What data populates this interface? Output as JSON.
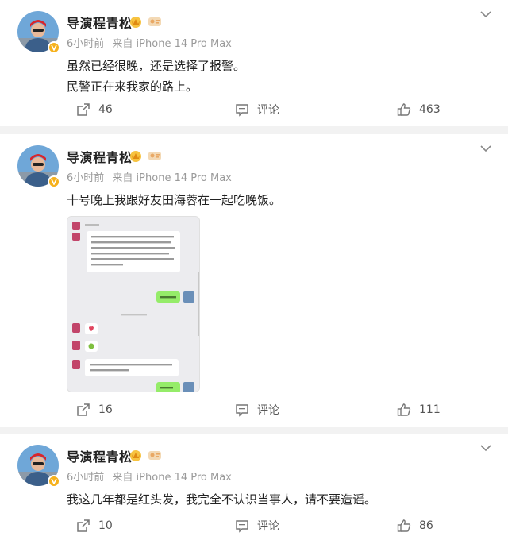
{
  "posts": [
    {
      "author": "导演程青松",
      "time": "6小时前",
      "source": "来自 iPhone 14 Pro Max",
      "lines": [
        "虽然已经很晚，还是选择了报警。",
        "民警正在来我家的路上。"
      ],
      "shares": "46",
      "comment_label": "评论",
      "likes": "463"
    },
    {
      "author": "导演程青松",
      "time": "6小时前",
      "source": "来自 iPhone 14 Pro Max",
      "lines": [
        "十号晚上我跟好友田海蓉在一起吃晚饭。"
      ],
      "shares": "16",
      "comment_label": "评论",
      "likes": "111"
    },
    {
      "author": "导演程青松",
      "time": "6小时前",
      "source": "来自 iPhone 14 Pro Max",
      "lines": [
        "我这几年都是红头发，我完全不认识当事人，请不要造谣。"
      ],
      "shares": "10",
      "comment_label": "评论",
      "likes": "86"
    }
  ],
  "colors": {
    "background": "#f2f2f2",
    "card": "#ffffff",
    "meta_text": "#9a9a9a",
    "badge": "#f6b11c",
    "chat_green": "#95ec69"
  },
  "icons": {
    "more": "chevron-down-icon",
    "share": "share-icon",
    "comment": "comment-icon",
    "like": "thumbs-up-icon",
    "verified": "verified-badge-icon",
    "crown": "crown-icon",
    "member": "member-icon"
  }
}
